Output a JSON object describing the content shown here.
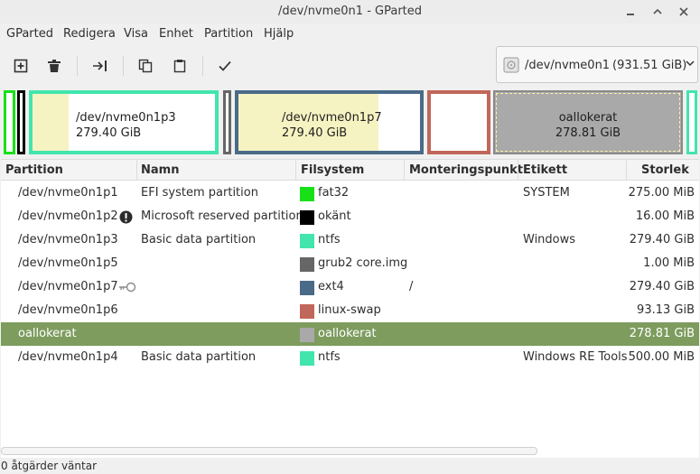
{
  "window": {
    "title": "/dev/nvme0n1 - GParted"
  },
  "menu": [
    "GParted",
    "Redigera",
    "Visa",
    "Enhet",
    "Partition",
    "Hjälp"
  ],
  "device": {
    "name": "/dev/nvme0n1",
    "size": "(931.51 GiB)"
  },
  "diskmap": {
    "p3": {
      "name": "/dev/nvme0n1p3",
      "size": "279.40 GiB",
      "used_fraction": 0.2
    },
    "p7": {
      "name": "/dev/nvme0n1p7",
      "size": "279.40 GiB",
      "used_fraction": 0.77
    },
    "unalloc": {
      "name": "oallokerat",
      "size": "278.81 GiB"
    }
  },
  "columns": [
    "Partition",
    "Namn",
    "Filsystem",
    "Monteringspunkt",
    "Etikett",
    "Storlek"
  ],
  "rows": [
    {
      "partition": "/dev/nvme0n1p1",
      "name": "EFI system partition",
      "fs": "fat32",
      "fs_color": "#18e018",
      "mount": "",
      "label": "SYSTEM",
      "size": "275.00 MiB",
      "icon": ""
    },
    {
      "partition": "/dev/nvme0n1p2",
      "name": "Microsoft reserved partition",
      "fs": "okänt",
      "fs_color": "#000000",
      "mount": "",
      "label": "",
      "size": "16.00 MiB",
      "icon": "warning-icon"
    },
    {
      "partition": "/dev/nvme0n1p3",
      "name": "Basic data partition",
      "fs": "ntfs",
      "fs_color": "#42e5ac",
      "mount": "",
      "label": "Windows",
      "size": "279.40 GiB",
      "icon": ""
    },
    {
      "partition": "/dev/nvme0n1p5",
      "name": "",
      "fs": "grub2 core.img",
      "fs_color": "#666666",
      "mount": "",
      "label": "",
      "size": "1.00 MiB",
      "icon": ""
    },
    {
      "partition": "/dev/nvme0n1p7",
      "name": "",
      "fs": "ext4",
      "fs_color": "#4a6a88",
      "mount": "/",
      "label": "",
      "size": "279.40 GiB",
      "icon": "key-icon"
    },
    {
      "partition": "/dev/nvme0n1p6",
      "name": "",
      "fs": "linux-swap",
      "fs_color": "#c1665a",
      "mount": "",
      "label": "",
      "size": "93.13 GiB",
      "icon": ""
    },
    {
      "partition": "oallokerat",
      "name": "",
      "fs": "oallokerat",
      "fs_color": "#a9a9a9",
      "mount": "",
      "label": "",
      "size": "278.81 GiB",
      "icon": "",
      "selected": true
    },
    {
      "partition": "/dev/nvme0n1p4",
      "name": "Basic data partition",
      "fs": "ntfs",
      "fs_color": "#42e5ac",
      "mount": "",
      "label": "Windows RE Tools",
      "size": "500.00 MiB",
      "icon": ""
    }
  ],
  "status": "0 åtgärder väntar"
}
